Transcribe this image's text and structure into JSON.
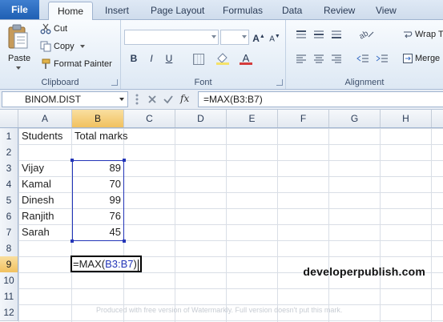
{
  "ribbon_tabs": [
    "File",
    "Home",
    "Insert",
    "Page Layout",
    "Formulas",
    "Data",
    "Review",
    "View"
  ],
  "clipboard": {
    "paste": "Paste",
    "cut": "Cut",
    "copy": "Copy",
    "format_painter": "Format Painter",
    "label": "Clipboard"
  },
  "font": {
    "bold": "B",
    "italic": "I",
    "underline": "U",
    "label": "Font"
  },
  "alignment": {
    "wrap_text": "Wrap T",
    "merge": "Merge",
    "label": "Alignment"
  },
  "formula_bar": {
    "name_box": "BINOM.DIST",
    "fx": "fx",
    "formula": "=MAX(B3:B7)"
  },
  "columns": [
    "A",
    "B",
    "C",
    "D",
    "E",
    "F",
    "G",
    "H"
  ],
  "rows": [
    "1",
    "2",
    "3",
    "4",
    "5",
    "6",
    "7",
    "8",
    "9",
    "10",
    "11",
    "12"
  ],
  "sheet": {
    "header_a": "Students",
    "header_b": "Total marks",
    "students": [
      {
        "name": "Vijay",
        "marks": "89"
      },
      {
        "name": "Kamal",
        "marks": "70"
      },
      {
        "name": "Dinesh",
        "marks": "99"
      },
      {
        "name": "Ranjith",
        "marks": "76"
      },
      {
        "name": "Sarah",
        "marks": "45"
      }
    ],
    "edit_prefix": "=MAX(",
    "edit_ref": "B3:B7",
    "edit_suffix": ")"
  },
  "watermark": "developerpublish.com",
  "trial_note": "Produced with free version of Watermarkly. Full version doesn't put this mark.",
  "colors": {
    "accent": "#2335b8",
    "active_header": "#f1c15f",
    "file_tab": "#1f5fb3"
  }
}
